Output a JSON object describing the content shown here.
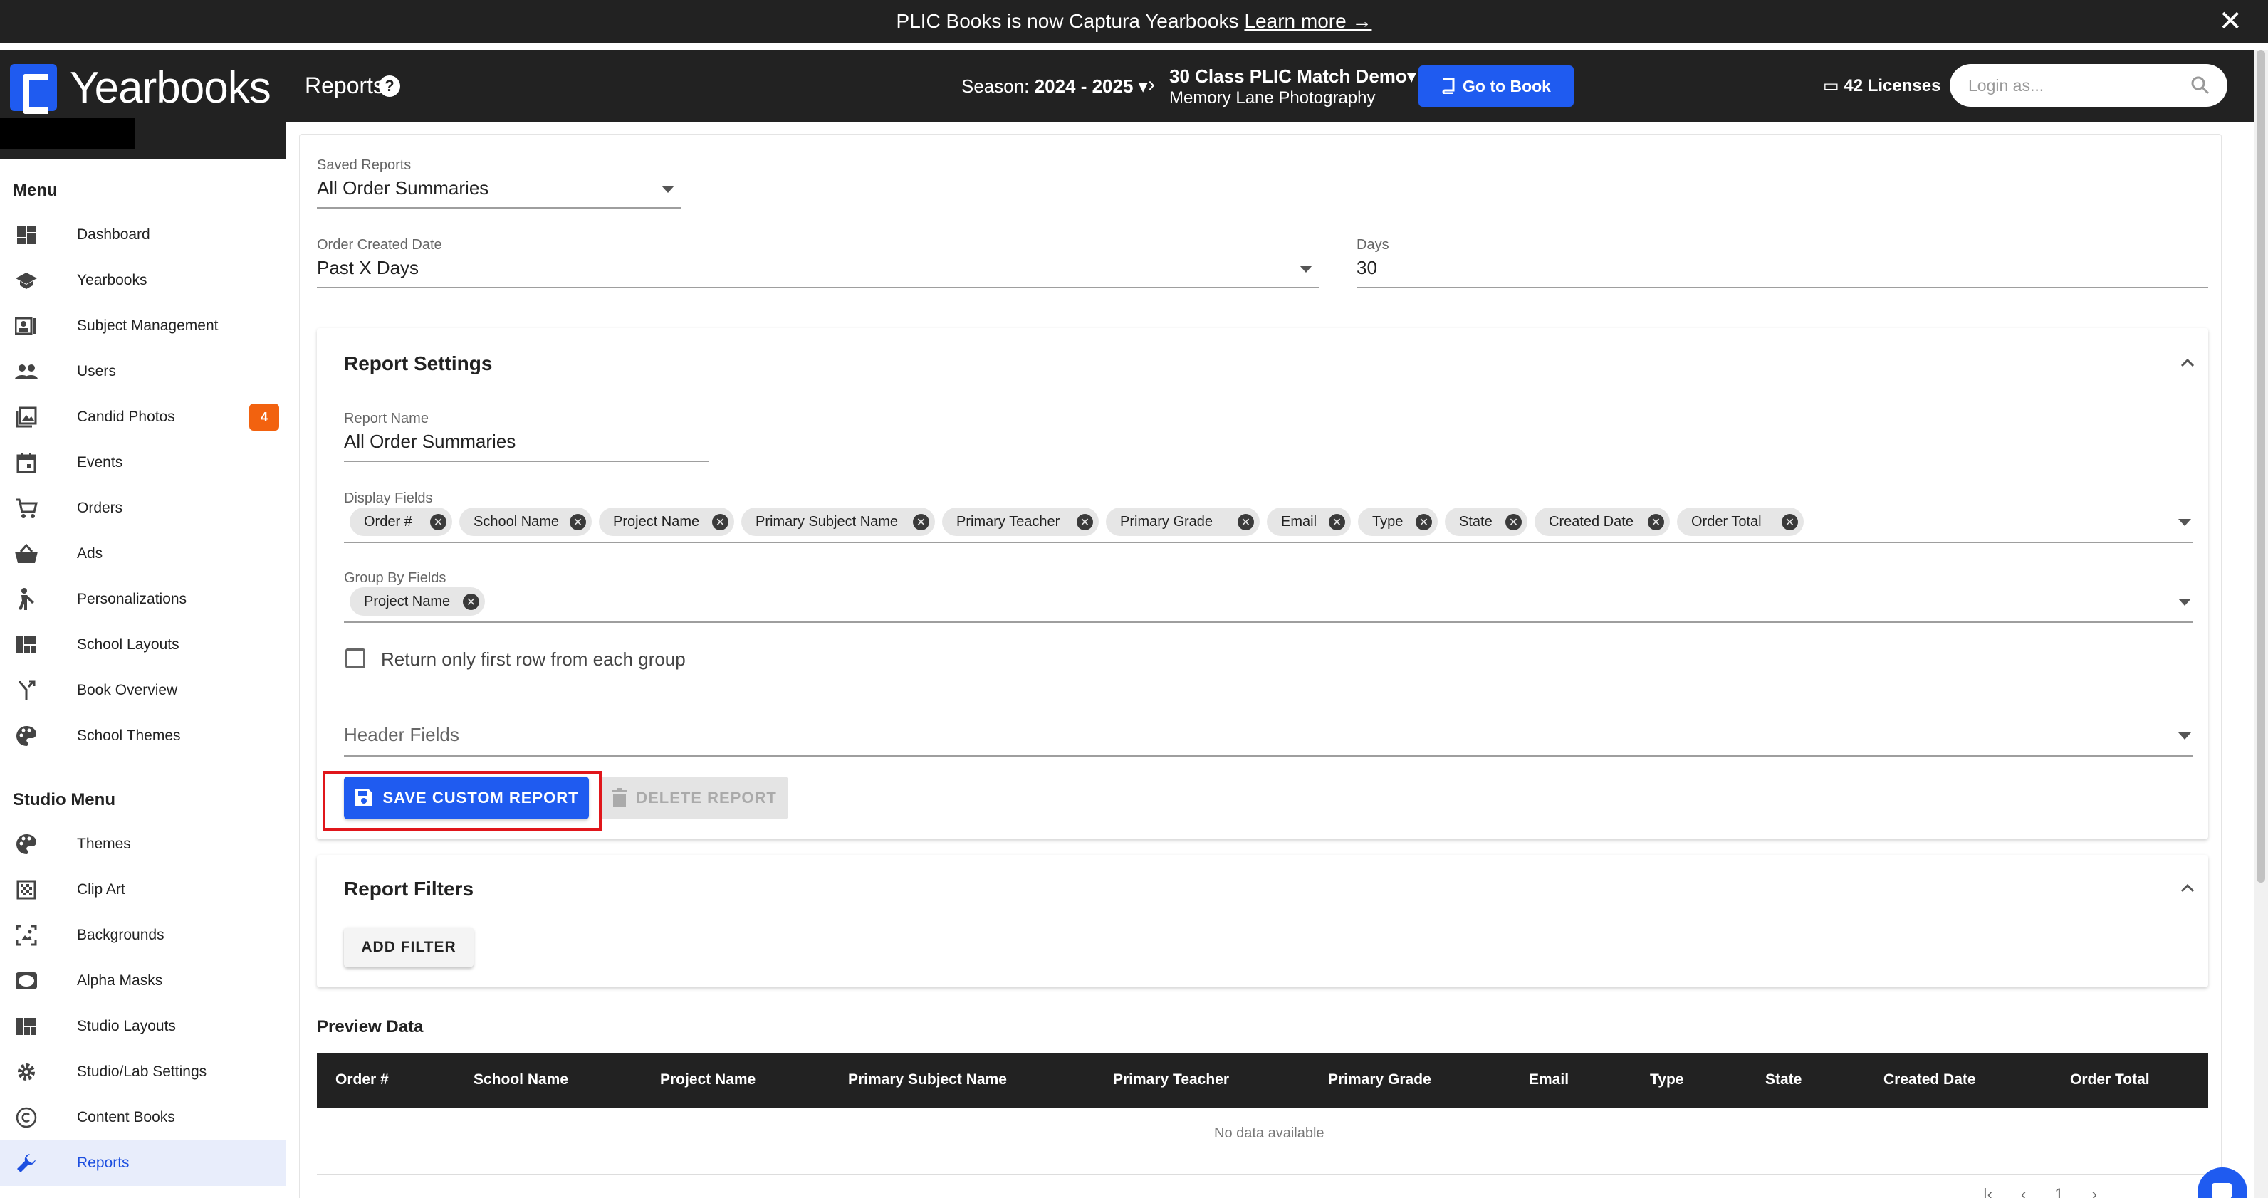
{
  "banner": {
    "text": "PLIC Books is now Captura Yearbooks",
    "link": "Learn more →"
  },
  "brand": {
    "name": "Yearbooks"
  },
  "topbar": {
    "title": "Reports",
    "season_label": "Season:",
    "season_value": "2024 - 2025",
    "project": "30 Class PLIC Match Demo",
    "studio": "Memory Lane Photography",
    "go_to_book": "Go to Book",
    "licenses": "42 Licenses",
    "login_placeholder": "Login as..."
  },
  "sidebar": {
    "menu_title": "Menu",
    "items": [
      {
        "label": "Dashboard",
        "icon": "dashboard-icon"
      },
      {
        "label": "Yearbooks",
        "icon": "school-icon"
      },
      {
        "label": "Subject Management",
        "icon": "id-card-icon"
      },
      {
        "label": "Users",
        "icon": "users-icon"
      },
      {
        "label": "Candid Photos",
        "icon": "photos-icon",
        "badge": "4"
      },
      {
        "label": "Events",
        "icon": "calendar-icon"
      },
      {
        "label": "Orders",
        "icon": "cart-icon"
      },
      {
        "label": "Ads",
        "icon": "basket-icon"
      },
      {
        "label": "Personalizations",
        "icon": "person-icon"
      },
      {
        "label": "School Layouts",
        "icon": "layout-icon"
      },
      {
        "label": "Book Overview",
        "icon": "merge-icon"
      },
      {
        "label": "School Themes",
        "icon": "palette-icon"
      }
    ],
    "studio_menu_title": "Studio Menu",
    "studio_items": [
      {
        "label": "Themes",
        "icon": "palette-icon"
      },
      {
        "label": "Clip Art",
        "icon": "clipart-icon"
      },
      {
        "label": "Backgrounds",
        "icon": "background-icon"
      },
      {
        "label": "Alpha Masks",
        "icon": "mask-icon"
      },
      {
        "label": "Studio Layouts",
        "icon": "layout-icon"
      },
      {
        "label": "Studio/Lab Settings",
        "icon": "gear-icon"
      },
      {
        "label": "Content Books",
        "icon": "copyright-icon"
      },
      {
        "label": "Reports",
        "icon": "wrench-icon",
        "active": true
      }
    ]
  },
  "filters": {
    "saved_reports_label": "Saved Reports",
    "saved_reports_value": "All Order Summaries",
    "order_created_label": "Order Created Date",
    "order_created_value": "Past X Days",
    "days_label": "Days",
    "days_value": "30"
  },
  "report_settings": {
    "title": "Report Settings",
    "report_name_label": "Report Name",
    "report_name_value": "All Order Summaries",
    "display_fields_label": "Display Fields",
    "display_fields": [
      "Order #",
      "School Name",
      "Project Name",
      "Primary Subject Name",
      "Primary Teacher",
      "Primary Grade",
      "Email",
      "Type",
      "State",
      "Created Date",
      "Order Total"
    ],
    "group_by_label": "Group By Fields",
    "group_by_fields": [
      "Project Name"
    ],
    "first_row_label": "Return only first row from each group",
    "header_fields_label": "Header Fields",
    "save_button": "SAVE CUSTOM REPORT",
    "delete_button": "DELETE REPORT"
  },
  "report_filters": {
    "title": "Report Filters",
    "add_filter": "ADD FILTER"
  },
  "preview": {
    "title": "Preview Data",
    "columns": [
      "Order #",
      "School Name",
      "Project Name",
      "Primary Subject Name",
      "Primary Teacher",
      "Primary Grade",
      "Email",
      "Type",
      "State",
      "Created Date",
      "Order Total"
    ],
    "empty": "No data available",
    "page": "1"
  },
  "colors": {
    "accent": "#1f5bf0",
    "badge": "#f2620f",
    "highlight": "#e0161b",
    "dark": "#222222"
  }
}
